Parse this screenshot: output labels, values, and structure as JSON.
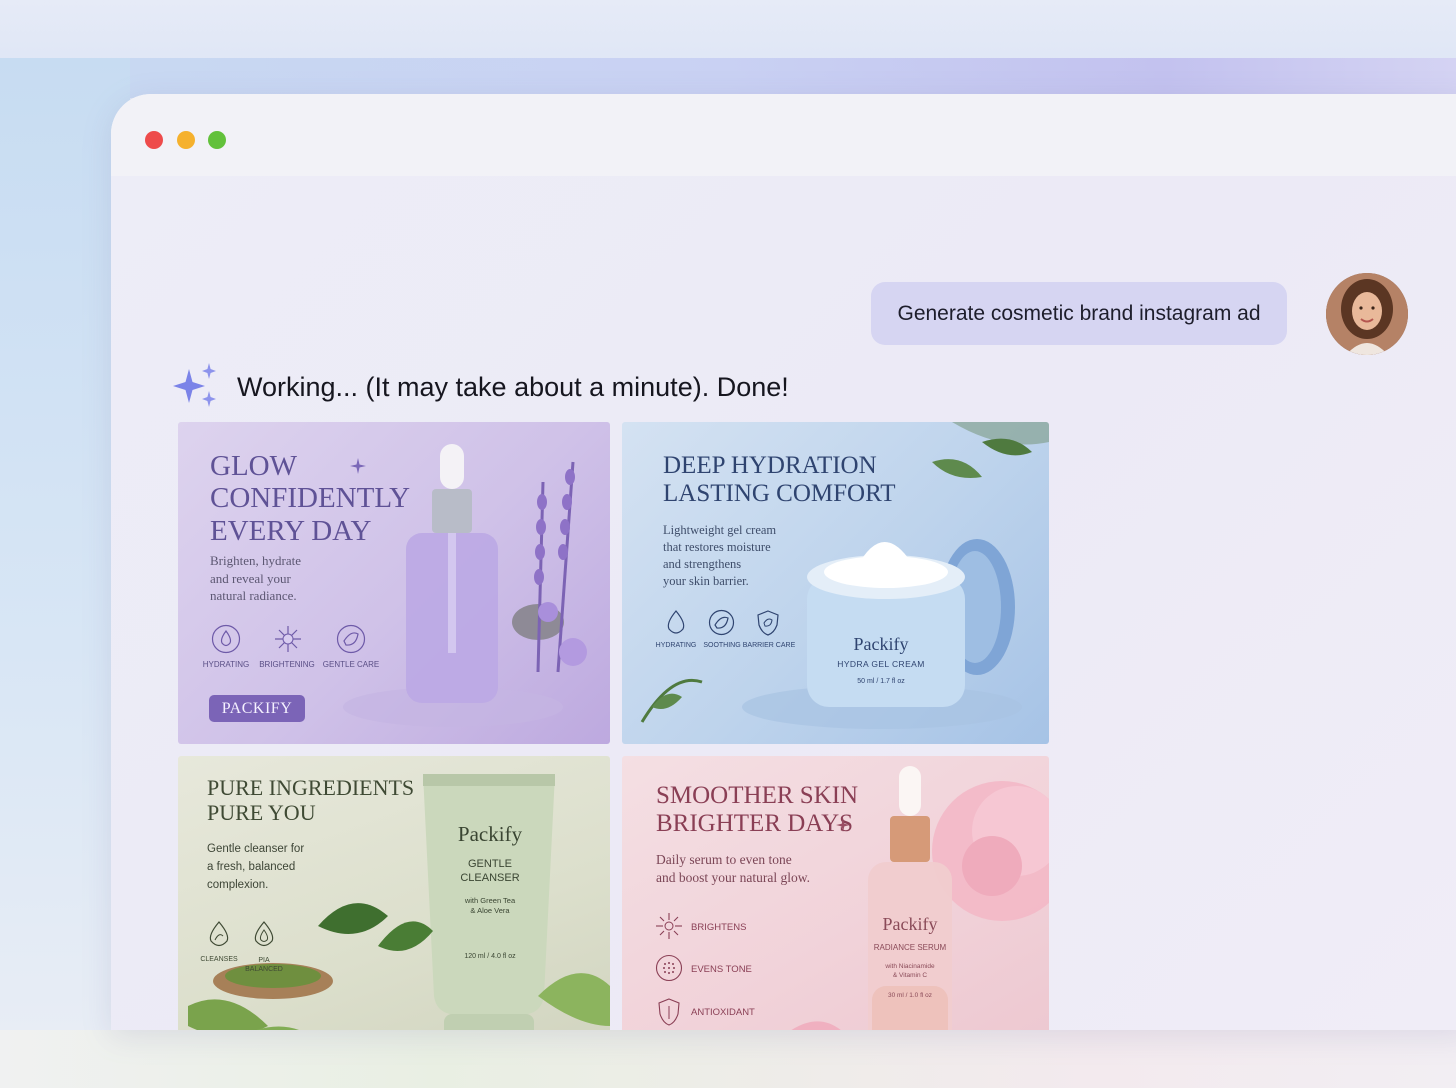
{
  "chat": {
    "user_message": "Generate cosmetic brand instagram ad",
    "assistant_status": "Working... (It may take about a minute). Done!"
  },
  "ads": [
    {
      "headline": [
        "GLOW",
        "CONFIDENTLY",
        "EVERY DAY"
      ],
      "body": [
        "Brighten, hydrate",
        "and reveal your",
        "natural radiance."
      ],
      "features": [
        "HYDRATING",
        "BRIGHTENING",
        "GENTLE CARE"
      ],
      "brand_button": "PACKIFY",
      "accent": "#6e5aa8"
    },
    {
      "headline": [
        "DEEP HYDRATION",
        "LASTING COMFORT"
      ],
      "body": [
        "Lightweight gel cream",
        "that restores moisture",
        "and strengthens",
        "your skin barrier."
      ],
      "features": [
        "HYDRATING",
        "SOOTHING",
        "BARRIER CARE"
      ],
      "product_brand": "Packify",
      "product_name": "HYDRA GEL CREAM",
      "product_size": "50 ml / 1.7 fl oz",
      "accent": "#2f4470"
    },
    {
      "headline": [
        "PURE INGREDIENTS",
        "PURE YOU"
      ],
      "body": [
        "Gentle cleanser for",
        "a fresh, balanced",
        "complexion."
      ],
      "features": [
        "CLEANSES",
        "PIA BALANCED"
      ],
      "product_brand": "Packify",
      "product_name": [
        "GENTLE",
        "CLEANSER"
      ],
      "product_detail": [
        "with Green Tea",
        "& Aloe Vera"
      ],
      "product_size": "120 ml / 4.0 fl oz",
      "accent": "#3f4a34"
    },
    {
      "headline": [
        "SMOOTHER SKIN",
        "BRIGHTER DAYS"
      ],
      "body": [
        "Daily serum to even tone",
        "and boost your natural glow."
      ],
      "features": [
        "BRIGHTENS",
        "EVENS TONE",
        "ANTIOXIDANT"
      ],
      "product_brand": "Packify",
      "product_name": "RADIANCE SERUM",
      "product_detail": [
        "with Niacinamide",
        "& Vitamin C"
      ],
      "product_size": "30 ml / 1.0 fl oz",
      "accent": "#8a3f55"
    }
  ]
}
